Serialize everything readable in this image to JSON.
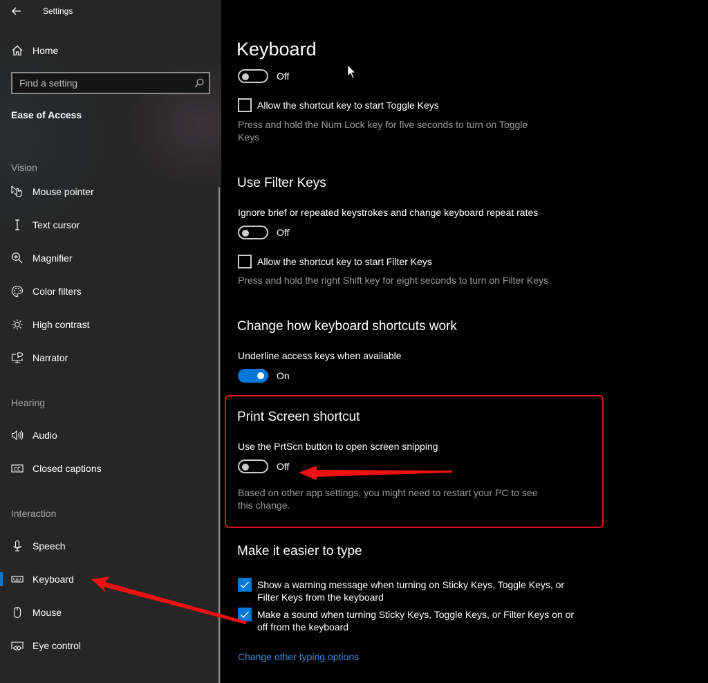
{
  "window": {
    "title": "Settings",
    "back_icon": "arrow-left-icon"
  },
  "sidebar": {
    "home": {
      "label": "Home",
      "icon": "home-icon"
    },
    "search": {
      "placeholder": "Find a setting",
      "value": "",
      "icon": "search-icon"
    },
    "section_title": "Ease of Access",
    "groups": [
      {
        "header": "Vision",
        "items": [
          {
            "label": "Mouse pointer",
            "icon": "mouse-pointer-icon"
          },
          {
            "label": "Text cursor",
            "icon": "text-cursor-icon"
          },
          {
            "label": "Magnifier",
            "icon": "magnifier-icon"
          },
          {
            "label": "Color filters",
            "icon": "palette-icon"
          },
          {
            "label": "High contrast",
            "icon": "brightness-icon"
          },
          {
            "label": "Narrator",
            "icon": "narrator-icon"
          }
        ]
      },
      {
        "header": "Hearing",
        "items": [
          {
            "label": "Audio",
            "icon": "speaker-icon"
          },
          {
            "label": "Closed captions",
            "icon": "cc-icon"
          }
        ]
      },
      {
        "header": "Interaction",
        "items": [
          {
            "label": "Speech",
            "icon": "microphone-icon"
          },
          {
            "label": "Keyboard",
            "icon": "keyboard-icon",
            "active": true
          },
          {
            "label": "Mouse",
            "icon": "mouse-icon"
          },
          {
            "label": "Eye control",
            "icon": "eye-control-icon"
          }
        ]
      }
    ]
  },
  "main": {
    "title": "Keyboard",
    "toggle_keys": {
      "toggle_state": "Off",
      "shortcut_checkbox_label": "Allow the shortcut key to start Toggle Keys",
      "shortcut_checked": false,
      "shortcut_desc": "Press and hold the Num Lock key for five seconds to turn on Toggle Keys"
    },
    "filter_keys": {
      "heading": "Use Filter Keys",
      "label": "Ignore brief or repeated keystrokes and change keyboard repeat rates",
      "toggle_state": "Off",
      "shortcut_checkbox_label": "Allow the shortcut key to start Filter Keys",
      "shortcut_checked": false,
      "shortcut_desc": "Press and hold the right Shift key for eight seconds to turn on Filter Keys"
    },
    "shortcuts": {
      "heading": "Change how keyboard shortcuts work",
      "label": "Underline access keys when available",
      "toggle_state": "On"
    },
    "print_screen": {
      "heading": "Print Screen shortcut",
      "label": "Use the PrtScn button to open screen snipping",
      "toggle_state": "Off",
      "desc": "Based on other app settings, you might need to restart your PC to see this change."
    },
    "easier_type": {
      "heading": "Make it easier to type",
      "options": [
        {
          "label": "Show a warning message when turning on Sticky Keys, Toggle Keys, or Filter Keys from the keyboard",
          "checked": true
        },
        {
          "label": "Make a sound when turning Sticky Keys, Toggle Keys, or Filter Keys on or off from the keyboard",
          "checked": true
        }
      ],
      "link": "Change other typing options"
    }
  },
  "colors": {
    "accent": "#0078d7",
    "annotation": "#e0141c",
    "link": "#3c8ad8"
  }
}
